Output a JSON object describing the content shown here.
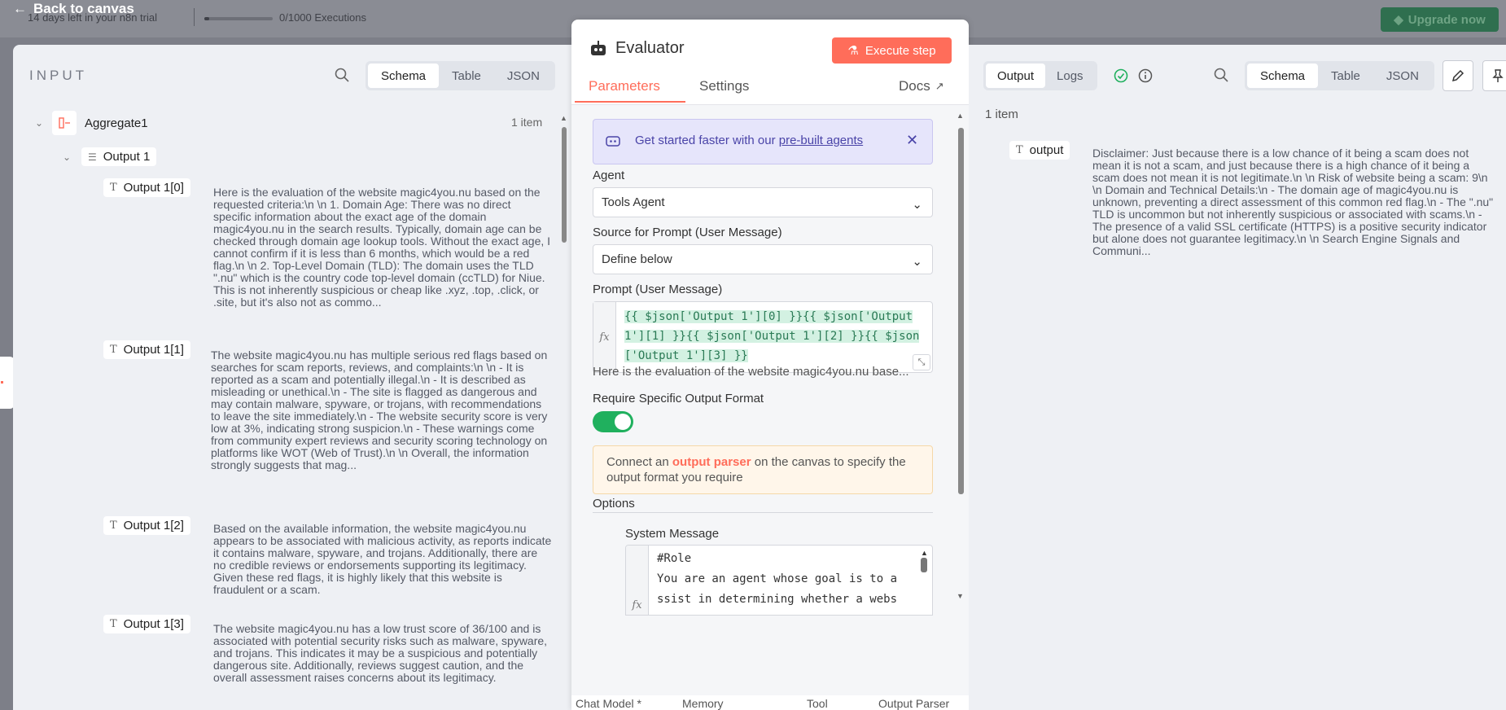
{
  "topbar": {
    "back_label": "Back to canvas",
    "trial_text": "14 days left in your n8n trial",
    "executions": "0/1000 Executions",
    "upgrade_label": "Upgrade now"
  },
  "input": {
    "title": "INPUT",
    "views": [
      "Schema",
      "Table",
      "JSON"
    ],
    "active_view": "Schema",
    "node_name": "Aggregate1",
    "item_count": "1 item",
    "group_label": "Output 1",
    "items": [
      {
        "label": "Output 1[0]",
        "text": "Here is the evaluation of the website magic4you.nu based on the requested criteria:\\n \\n 1. Domain Age: There was no direct specific information about the exact age of the domain magic4you.nu in the search results. Typically, domain age can be checked through domain age lookup tools. Without the exact age, I cannot confirm if it is less than 6 months, which would be a red flag.\\n \\n 2. Top-Level Domain (TLD): The domain uses the TLD \".nu\" which is the country code top-level domain (ccTLD) for Niue. This is not inherently suspicious or cheap like .xyz, .top, .click, or .site, but it's also not as commo..."
      },
      {
        "label": "Output 1[1]",
        "text": "The website magic4you.nu has multiple serious red flags based on searches for scam reports, reviews, and complaints:\\n \\n - It is reported as a scam and potentially illegal.\\n - It is described as misleading or unethical.\\n - The site is flagged as dangerous and may contain malware, spyware, or trojans, with recommendations to leave the site immediately.\\n - The website security score is very low at 3%, indicating strong suspicion.\\n - These warnings come from community expert reviews and security scoring technology on platforms like WOT (Web of Trust).\\n \\n Overall, the information strongly suggests that mag..."
      },
      {
        "label": "Output 1[2]",
        "text": "Based on the available information, the website magic4you.nu appears to be associated with malicious activity, as reports indicate it contains malware, spyware, and trojans. Additionally, there are no credible reviews or endorsements supporting its legitimacy. Given these red flags, it is highly likely that this website is fraudulent or a scam."
      },
      {
        "label": "Output 1[3]",
        "text": "The website magic4you.nu has a low trust score of 36/100 and is associated with potential security risks such as malware, spyware, and trojans. This indicates it may be a suspicious and potentially dangerous site. Additionally, reviews suggest caution, and the overall assessment raises concerns about its legitimacy."
      }
    ]
  },
  "evaluator": {
    "title": "Evaluator",
    "execute_label": "Execute step",
    "tabs": [
      "Parameters",
      "Settings"
    ],
    "docs_label": "Docs",
    "banner_prefix": "Get started faster with our ",
    "banner_link": "pre-built agents",
    "agent_label": "Agent",
    "agent_value": "Tools Agent",
    "source_label": "Source for Prompt (User Message)",
    "source_value": "Define below",
    "prompt_label": "Prompt (User Message)",
    "prompt_expression": "{{ $json['Output 1'][0] }}{{ $json['Output 1'][1] }}{{ $json['Output 1'][2] }}{{ $json['Output 1'][3] }}",
    "prompt_preview": "Here is the evaluation of the website magic4you.nu base...",
    "output_format_label": "Require Specific Output Format",
    "output_format_enabled": true,
    "notice_prefix": "Connect an ",
    "notice_link": "output parser",
    "notice_suffix": " on the canvas to specify the output format you require",
    "options_label": "Options",
    "system_label": "System Message",
    "system_lines": [
      "#Role",
      "You are an agent whose goal is to a",
      "ssist in determining whether a webs"
    ],
    "bottom_tabs": [
      "Chat Model *",
      "Memory",
      "Tool",
      "Output Parser"
    ]
  },
  "output": {
    "tabs": [
      "Output",
      "Logs"
    ],
    "active_tab": "Output",
    "views": [
      "Schema",
      "Table",
      "JSON"
    ],
    "active_view": "Schema",
    "item_count": "1 item",
    "field_label": "output",
    "field_value": "Disclaimer: Just because there is a low chance of it being a scam does not mean it is not a scam, and just because there is a high chance of it being a scam does not mean it is not legitimate.\\n \\n Risk of website being a scam: 9\\n \\n Domain and Technical Details:\\n - The domain age of magic4you.nu is unknown, preventing a direct assessment of this common red flag.\\n - The \".nu\" TLD is uncommon but not inherently suspicious or associated with scams.\\n - The presence of a valid SSL certificate (HTTPS) is a positive security indicator but alone does not guarantee legitimacy.\\n \\n Search Engine Signals and Communi..."
  },
  "colors": {
    "accent": "#ff6d5a",
    "success": "#20b05e",
    "upgrade": "#2f6f4f"
  }
}
